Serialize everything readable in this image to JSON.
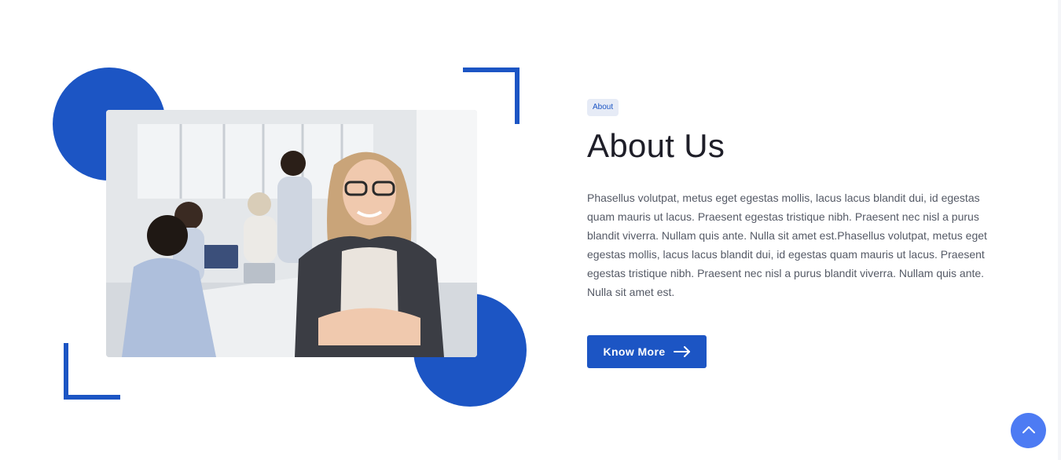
{
  "about": {
    "badge": "About",
    "title": "About Us",
    "description": "Phasellus volutpat, metus eget egestas mollis, lacus lacus blandit dui, id egestas quam mauris ut lacus. Praesent egestas tristique nibh. Praesent nec nisl a purus blandit viverra. Nullam quis ante. Nulla sit amet est.Phasellus volutpat, metus eget egestas mollis, lacus lacus blandit dui, id egestas quam mauris ut lacus. Praesent egestas tristique nibh. Praesent nec nisl a purus blandit viverra. Nullam quis ante. Nulla sit amet est.",
    "button_label": "Know More",
    "button_icon": "arrow-right-icon"
  },
  "image": {
    "subject": "team-office-photo"
  },
  "scroll_top": {
    "icon": "chevron-up-icon"
  },
  "colors": {
    "accent": "#1c55c4",
    "scroll_button": "#4d7bf3",
    "badge_bg": "#e6ebf6",
    "heading": "#1e1e28",
    "body_text": "#555a66"
  }
}
